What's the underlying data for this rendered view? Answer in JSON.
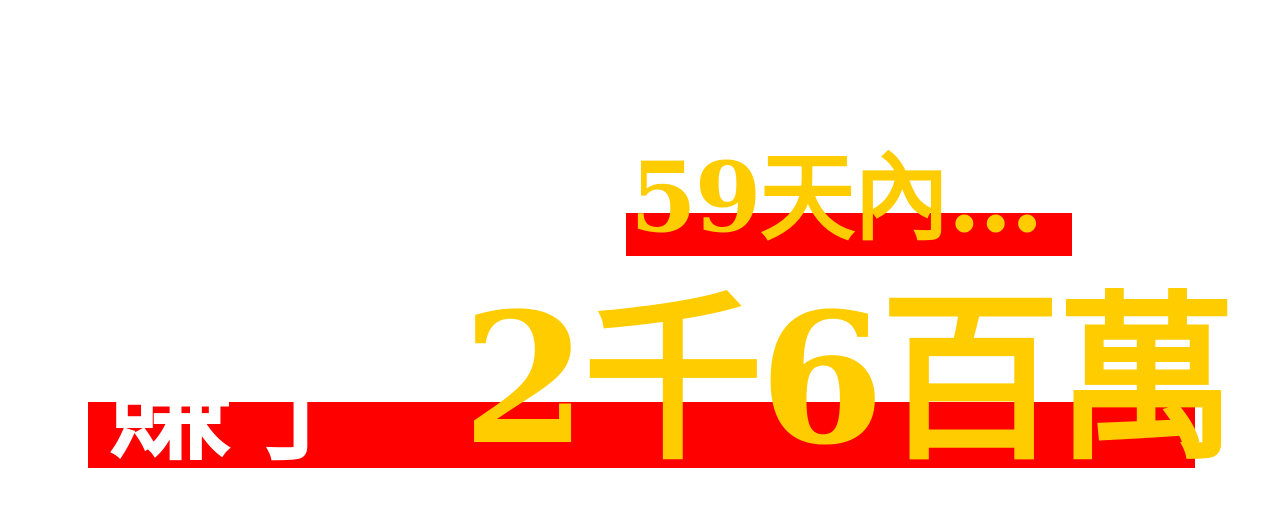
{
  "colors": {
    "background": "#ffffff",
    "band": "#ff0000",
    "headline": "#ffcc00",
    "clipped_text": "#ffffff"
  },
  "top_line": {
    "text": "59天內..."
  },
  "bottom_line": {
    "prefix": "賺了",
    "amount": "2千6百萬"
  }
}
